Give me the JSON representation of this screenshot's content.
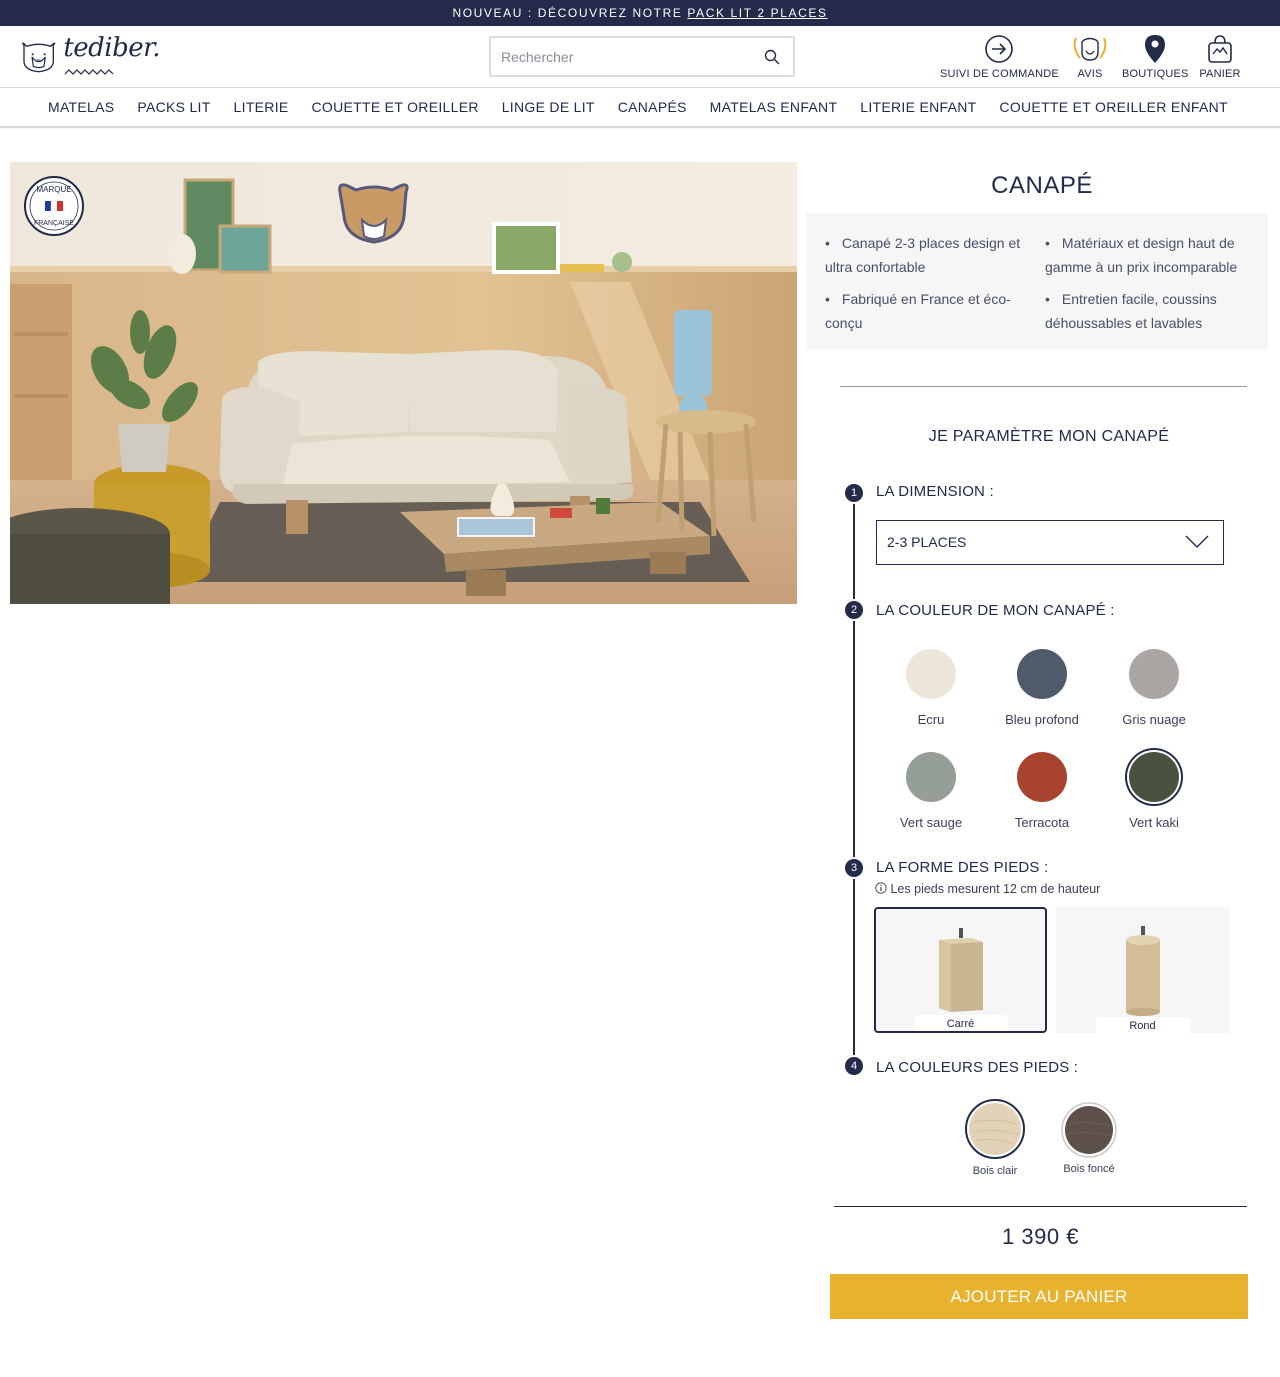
{
  "announcement": {
    "prefix": "NOUVEAU : DÉCOUVREZ NOTRE ",
    "link": "PACK LIT 2 PLACES"
  },
  "header": {
    "logo_text": "tediber.",
    "search_placeholder": "Rechercher",
    "links": {
      "order_tracking": "SUIVI DE COMMANDE",
      "reviews": "AVIS",
      "stores": "BOUTIQUES",
      "cart": "PANIER"
    }
  },
  "nav": {
    "items": [
      "MATELAS",
      "PACKS LIT",
      "LITERIE",
      "COUETTE ET OREILLER",
      "LINGE DE LIT",
      "CANAPÉS",
      "MATELAS ENFANT",
      "LITERIE ENFANT",
      "COUETTE ET OREILLER ENFANT"
    ]
  },
  "hero": {
    "badge_top": "MARQUE",
    "badge_bottom": "FRANÇAISE"
  },
  "product": {
    "title": "CANAPÉ",
    "features": [
      "Canapé 2-3 places design et ultra confortable",
      "Matériaux et design haut de gamme à un prix incomparable",
      "Fabriqué en France et éco-conçu",
      "Entretien facile, coussins déhoussables et lavables"
    ]
  },
  "configurator": {
    "title": "JE PARAMÈTRE MON CANAPÉ",
    "steps": [
      {
        "num": "1",
        "label": "LA DIMENSION :"
      },
      {
        "num": "2",
        "label": "LA COULEUR DE MON CANAPÉ :"
      },
      {
        "num": "3",
        "label": "LA FORME DES PIEDS :"
      },
      {
        "num": "4",
        "label": "LA COULEURS DES PIEDS :"
      }
    ],
    "dimension_value": "2-3 PLACES",
    "colors": [
      {
        "name": "Ecru",
        "hex": "#ede6d8",
        "selected": false
      },
      {
        "name": "Bleu profond",
        "hex": "#4f5a6b",
        "selected": false
      },
      {
        "name": "Gris nuage",
        "hex": "#aba5a3",
        "selected": false
      },
      {
        "name": "Vert sauge",
        "hex": "#959f98",
        "selected": false
      },
      {
        "name": "Terracota",
        "hex": "#a8432f",
        "selected": false
      },
      {
        "name": "Vert kaki",
        "hex": "#4a5140",
        "selected": true
      }
    ],
    "leg_note": "Les pieds mesurent 12 cm de hauteur",
    "leg_shapes": [
      {
        "name": "Carré",
        "selected": true
      },
      {
        "name": "Rond",
        "selected": false
      }
    ],
    "leg_colors": [
      {
        "name": "Bois clair",
        "hex": "#e2d2b8",
        "selected": true
      },
      {
        "name": "Bois foncé",
        "hex": "#5e514c",
        "selected": false
      }
    ]
  },
  "price": "1 390 €",
  "add_to_cart": "AJOUTER AU PANIER"
}
